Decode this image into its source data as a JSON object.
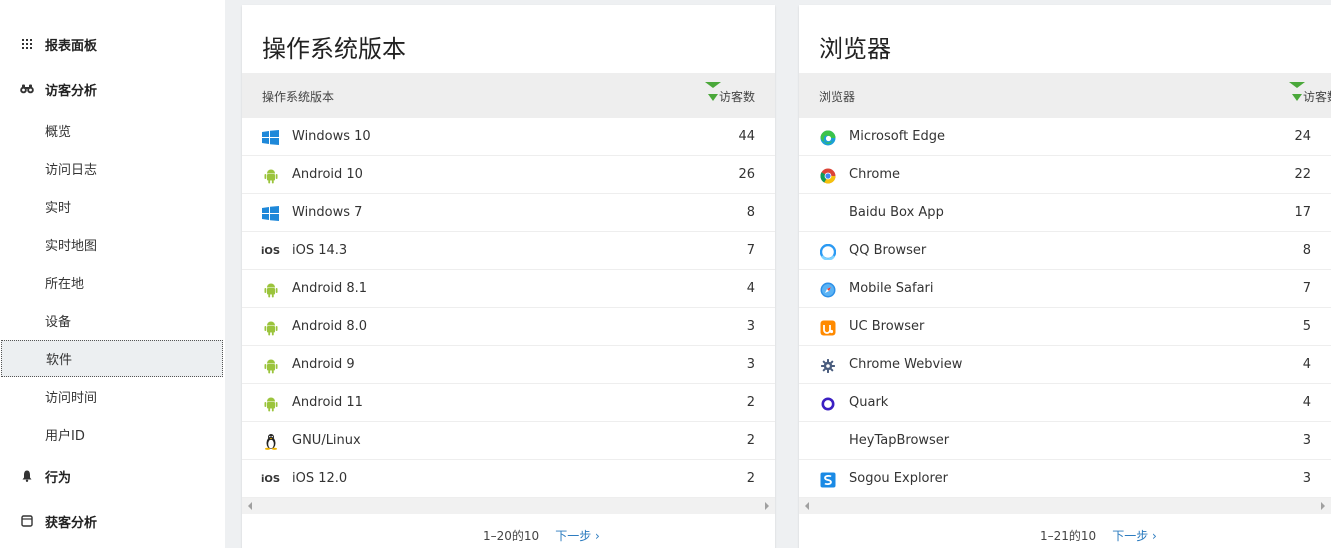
{
  "sidebar": {
    "sections": [
      {
        "label": "报表面板",
        "icon": "dashboard-grid-icon"
      },
      {
        "label": "访客分析",
        "icon": "binoculars-icon"
      },
      {
        "label": "行为",
        "icon": "bell-icon"
      },
      {
        "label": "获客分析",
        "icon": "square-icon"
      }
    ],
    "items": [
      {
        "label": "概览"
      },
      {
        "label": "访问日志"
      },
      {
        "label": "实时"
      },
      {
        "label": "实时地图"
      },
      {
        "label": "所在地"
      },
      {
        "label": "设备"
      },
      {
        "label": "软件"
      },
      {
        "label": "访问时间"
      },
      {
        "label": "用户ID"
      }
    ],
    "active_item": "软件"
  },
  "os_card": {
    "title": "操作系统版本",
    "col_label": "操作系统版本",
    "col_value": "访客数",
    "rows": [
      {
        "label": "Windows 10",
        "value": "44",
        "icon": "windows-icon"
      },
      {
        "label": "Android 10",
        "value": "26",
        "icon": "android-icon"
      },
      {
        "label": "Windows 7",
        "value": "8",
        "icon": "windows-icon"
      },
      {
        "label": "iOS 14.3",
        "value": "7",
        "icon": "ios-icon",
        "icon_text": "iOS"
      },
      {
        "label": "Android 8.1",
        "value": "4",
        "icon": "android-icon"
      },
      {
        "label": "Android 8.0",
        "value": "3",
        "icon": "android-icon"
      },
      {
        "label": "Android 9",
        "value": "3",
        "icon": "android-icon"
      },
      {
        "label": "Android 11",
        "value": "2",
        "icon": "android-icon"
      },
      {
        "label": "GNU/Linux",
        "value": "2",
        "icon": "linux-icon"
      },
      {
        "label": "iOS 12.0",
        "value": "2",
        "icon": "ios-icon",
        "icon_text": "iOS"
      }
    ],
    "pager_count": "1–20的10",
    "pager_next": "下一步 ›"
  },
  "browser_card": {
    "title": "浏览器",
    "col_label": "浏览器",
    "col_value": "访客数",
    "rows": [
      {
        "label": "Microsoft Edge",
        "value": "24",
        "icon": "edge-icon"
      },
      {
        "label": "Chrome",
        "value": "22",
        "icon": "chrome-icon"
      },
      {
        "label": "Baidu Box App",
        "value": "17",
        "icon": ""
      },
      {
        "label": "QQ Browser",
        "value": "8",
        "icon": "qq-browser-icon"
      },
      {
        "label": "Mobile Safari",
        "value": "7",
        "icon": "safari-icon"
      },
      {
        "label": "UC Browser",
        "value": "5",
        "icon": "uc-browser-icon"
      },
      {
        "label": "Chrome Webview",
        "value": "4",
        "icon": "gear-icon"
      },
      {
        "label": "Quark",
        "value": "4",
        "icon": "quark-icon"
      },
      {
        "label": "HeyTapBrowser",
        "value": "3",
        "icon": ""
      },
      {
        "label": "Sogou Explorer",
        "value": "3",
        "icon": "sogou-icon"
      }
    ],
    "pager_count": "1–21的10",
    "pager_next": "下一步 ›"
  },
  "colors": {
    "sort_green": "#4aa83a",
    "link_blue": "#2b7bbf",
    "windows_blue": "#1e88d9",
    "android_green": "#9bc43c"
  }
}
